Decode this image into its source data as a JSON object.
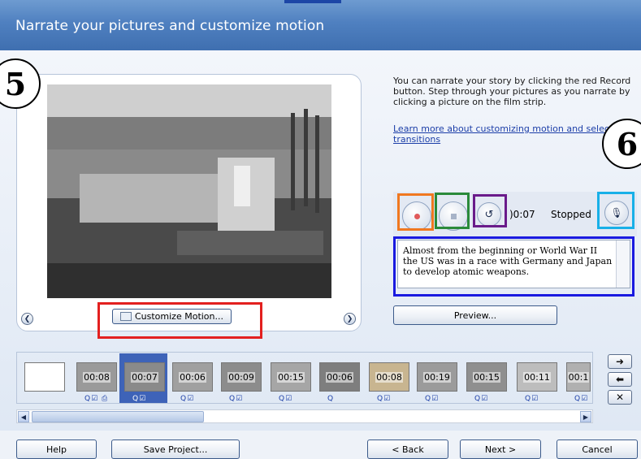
{
  "header": {
    "title": "Narrate your pictures and customize motion"
  },
  "callouts": {
    "left": "5",
    "right": "6"
  },
  "preview": {
    "customize_motion_label": "Customize Motion..."
  },
  "info": {
    "description": "You can narrate your story by clicking the red Record button. Step through your pictures as you narrate by clicking a picture on the film strip.",
    "learn_more_link": "Learn more about customizing motion and select transitions"
  },
  "recorder": {
    "time": ")0:07",
    "state": "Stopped",
    "record_icon": "record-icon",
    "stop_icon": "stop-icon",
    "undo_icon": "undo-icon",
    "mic_icon": "microphone-icon"
  },
  "narration": {
    "text": "Almost from the beginning or World War II the US was in a race with Germany and Japan to develop atomic weapons."
  },
  "preview_button": "Preview...",
  "filmstrip": {
    "thumbnails": [
      {
        "time": "",
        "icons": ""
      },
      {
        "time": "00:08",
        "icons": "Q☑ ⎙"
      },
      {
        "time": "00:07",
        "icons": "Q☑"
      },
      {
        "time": "00:06",
        "icons": "Q☑"
      },
      {
        "time": "00:09",
        "icons": "Q☑"
      },
      {
        "time": "00:15",
        "icons": "Q☑"
      },
      {
        "time": "00:06",
        "icons": "Q"
      },
      {
        "time": "00:08",
        "icons": "Q☑"
      },
      {
        "time": "00:19",
        "icons": "Q☑"
      },
      {
        "time": "00:15",
        "icons": "Q☑"
      },
      {
        "time": "00:11",
        "icons": "Q☑"
      },
      {
        "time": "00:1",
        "icons": "Q☑"
      }
    ]
  },
  "footer": {
    "help": "Help",
    "save_project": "Save Project...",
    "back": "< Back",
    "next": "Next >",
    "cancel": "Cancel"
  },
  "colors": {
    "header": "#4f80c0",
    "record_outline": "#f07820",
    "stop_outline": "#2a8a3a",
    "undo_outline": "#6a1a8a",
    "mic_outline": "#18b0e8",
    "narration_outline": "#1a1ae0",
    "customize_outline": "#e3201f"
  }
}
